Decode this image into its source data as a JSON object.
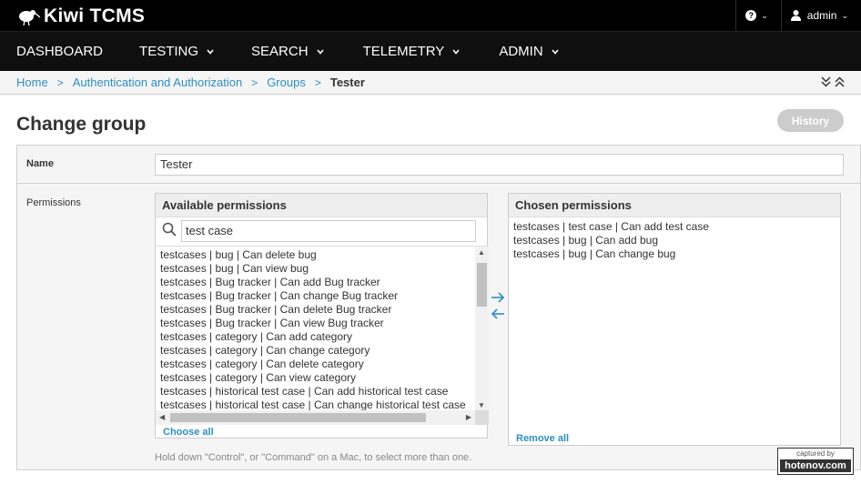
{
  "app": {
    "logo_text": "Kiwi TCMS",
    "help_label": "?",
    "user_label": "admin"
  },
  "nav": {
    "items": [
      {
        "label": "DASHBOARD"
      },
      {
        "label": "TESTING"
      },
      {
        "label": "SEARCH"
      },
      {
        "label": "TELEMETRY"
      },
      {
        "label": "ADMIN"
      }
    ]
  },
  "breadcrumb": {
    "home": "Home",
    "auth": "Authentication and Authorization",
    "groups": "Groups",
    "current": "Tester",
    "separator": ">"
  },
  "page": {
    "title": "Change group",
    "history_button": "History"
  },
  "form": {
    "name_label": "Name",
    "name_value": "Tester",
    "permissions_label": "Permissions",
    "available_title": "Available permissions",
    "filter_value": "test case",
    "available": [
      "testcases | bug | Can delete bug",
      "testcases | bug | Can view bug",
      "testcases | Bug tracker | Can add Bug tracker",
      "testcases | Bug tracker | Can change Bug tracker",
      "testcases | Bug tracker | Can delete Bug tracker",
      "testcases | Bug tracker | Can view Bug tracker",
      "testcases | category | Can add category",
      "testcases | category | Can change category",
      "testcases | category | Can delete category",
      "testcases | category | Can view category",
      "testcases | historical test case | Can add historical test case",
      "testcases | historical test case | Can change historical test case"
    ],
    "choose_all": "Choose all",
    "chosen_title": "Chosen permissions",
    "chosen": [
      "testcases | test case | Can add test case",
      "testcases | bug | Can add bug",
      "testcases | bug | Can change bug"
    ],
    "remove_all": "Remove all",
    "help_text": "Hold down \"Control\", or \"Command\" on a Mac, to select more than one."
  },
  "watermark": {
    "line1": "captured by",
    "line2": "hotenov.com"
  },
  "colors": {
    "topbar": "#000000",
    "link": "#2c8fc3",
    "history_button": "#cccccc"
  }
}
